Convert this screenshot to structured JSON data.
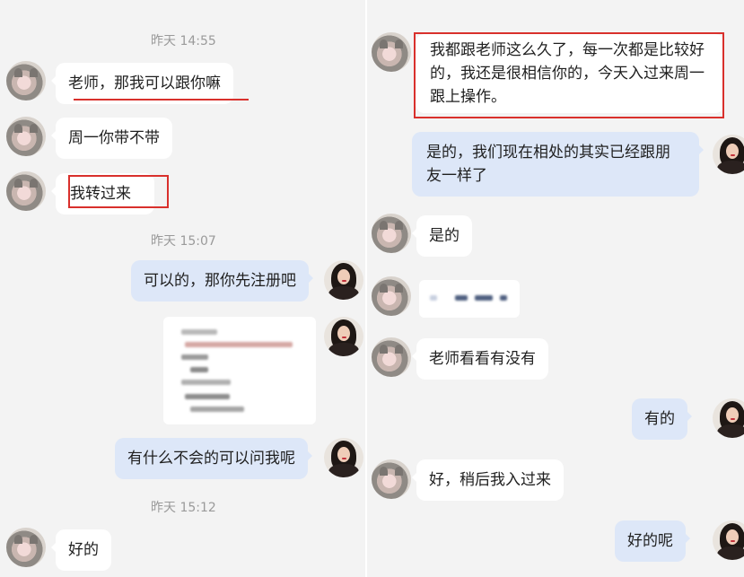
{
  "left_chat": {
    "time_1": "昨天 14:55",
    "msg_1": "老师，那我可以跟你嘛",
    "msg_2": "周一你带不带",
    "msg_3": "我转过来",
    "time_2": "昨天 15:07",
    "msg_4": "可以的，那你先注册吧",
    "msg_5": "有什么不会的可以问我呢",
    "time_3": "昨天 15:12",
    "msg_6": "好的"
  },
  "right_chat": {
    "msg_1": "我都跟老师这么久了，每一次都是比较好的，我还是很相信你的，今天入过来周一跟上操作。",
    "msg_2": "是的，我们现在相处的其实已经跟朋友一样了",
    "msg_3": "是的",
    "msg_4": "老师看看有没有",
    "msg_5": "有的",
    "msg_6": "好，稍后我入过来",
    "msg_7": "好的呢"
  },
  "colors": {
    "sent_bubble": "#dde7f8",
    "received_bubble": "#ffffff",
    "background": "#f3f3f3",
    "highlight": "#d9302c"
  },
  "icons": {
    "contact_avatar": "cat-photo-avatar",
    "teacher_avatar": "woman-photo-avatar"
  }
}
